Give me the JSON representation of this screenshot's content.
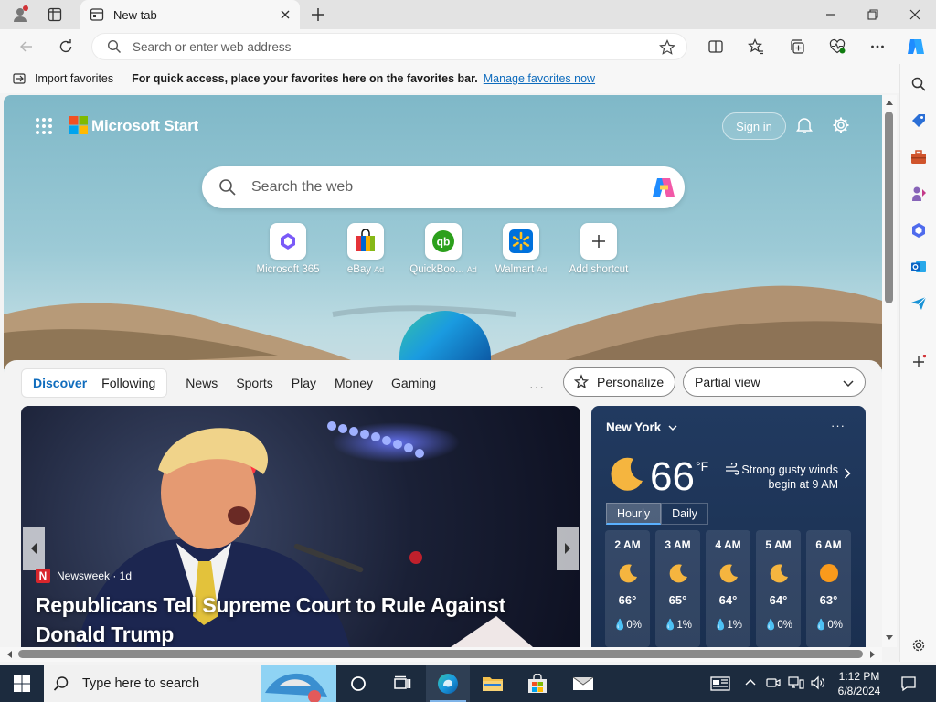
{
  "browser": {
    "tab_title": "New tab",
    "omnibox_placeholder": "Search or enter web address"
  },
  "favorites_bar": {
    "import_label": "Import favorites",
    "hint": "For quick access, place your favorites here on the favorites bar.",
    "manage_link": "Manage favorites now"
  },
  "start": {
    "brand": "Microsoft Start",
    "signin": "Sign in",
    "search_placeholder": "Search the web",
    "tiles": [
      {
        "label": "Microsoft 365",
        "ad": ""
      },
      {
        "label": "eBay",
        "ad": "Ad"
      },
      {
        "label": "QuickBoo...",
        "ad": "Ad"
      },
      {
        "label": "Walmart",
        "ad": "Ad"
      },
      {
        "label": "Add shortcut",
        "ad": ""
      }
    ]
  },
  "feed": {
    "segments": [
      "Discover",
      "Following"
    ],
    "nav": [
      "News",
      "Sports",
      "Play",
      "Money",
      "Gaming"
    ],
    "more": "···",
    "personalize": "Personalize",
    "view_select": "Partial view",
    "hero": {
      "source": "Newsweek · 1d",
      "source_logo": "N",
      "headline": "Republicans Tell Supreme Court to Rule Against Donald Trump"
    },
    "weather": {
      "location": "New York",
      "more": "···",
      "temp": "66",
      "unit": "°F",
      "description": "Strong gusty winds begin at 9 AM",
      "tabs": [
        "Hourly",
        "Daily"
      ],
      "hours": [
        {
          "time": "2 AM",
          "temp": "66°",
          "precip": "0%",
          "icon": "moon-icon"
        },
        {
          "time": "3 AM",
          "temp": "65°",
          "precip": "1%",
          "icon": "moon-icon"
        },
        {
          "time": "4 AM",
          "temp": "64°",
          "precip": "1%",
          "icon": "moon-icon"
        },
        {
          "time": "5 AM",
          "temp": "64°",
          "precip": "0%",
          "icon": "moon-icon"
        },
        {
          "time": "6 AM",
          "temp": "63°",
          "precip": "0%",
          "icon": "sun-icon"
        }
      ]
    }
  },
  "taskbar": {
    "search_placeholder": "Type here to search",
    "time": "1:12 PM",
    "date": "6/8/2024"
  },
  "colors": {
    "accent": "#0f6cbd",
    "taskbar": "#1c2b3e",
    "weather_card": "#1e3558"
  }
}
